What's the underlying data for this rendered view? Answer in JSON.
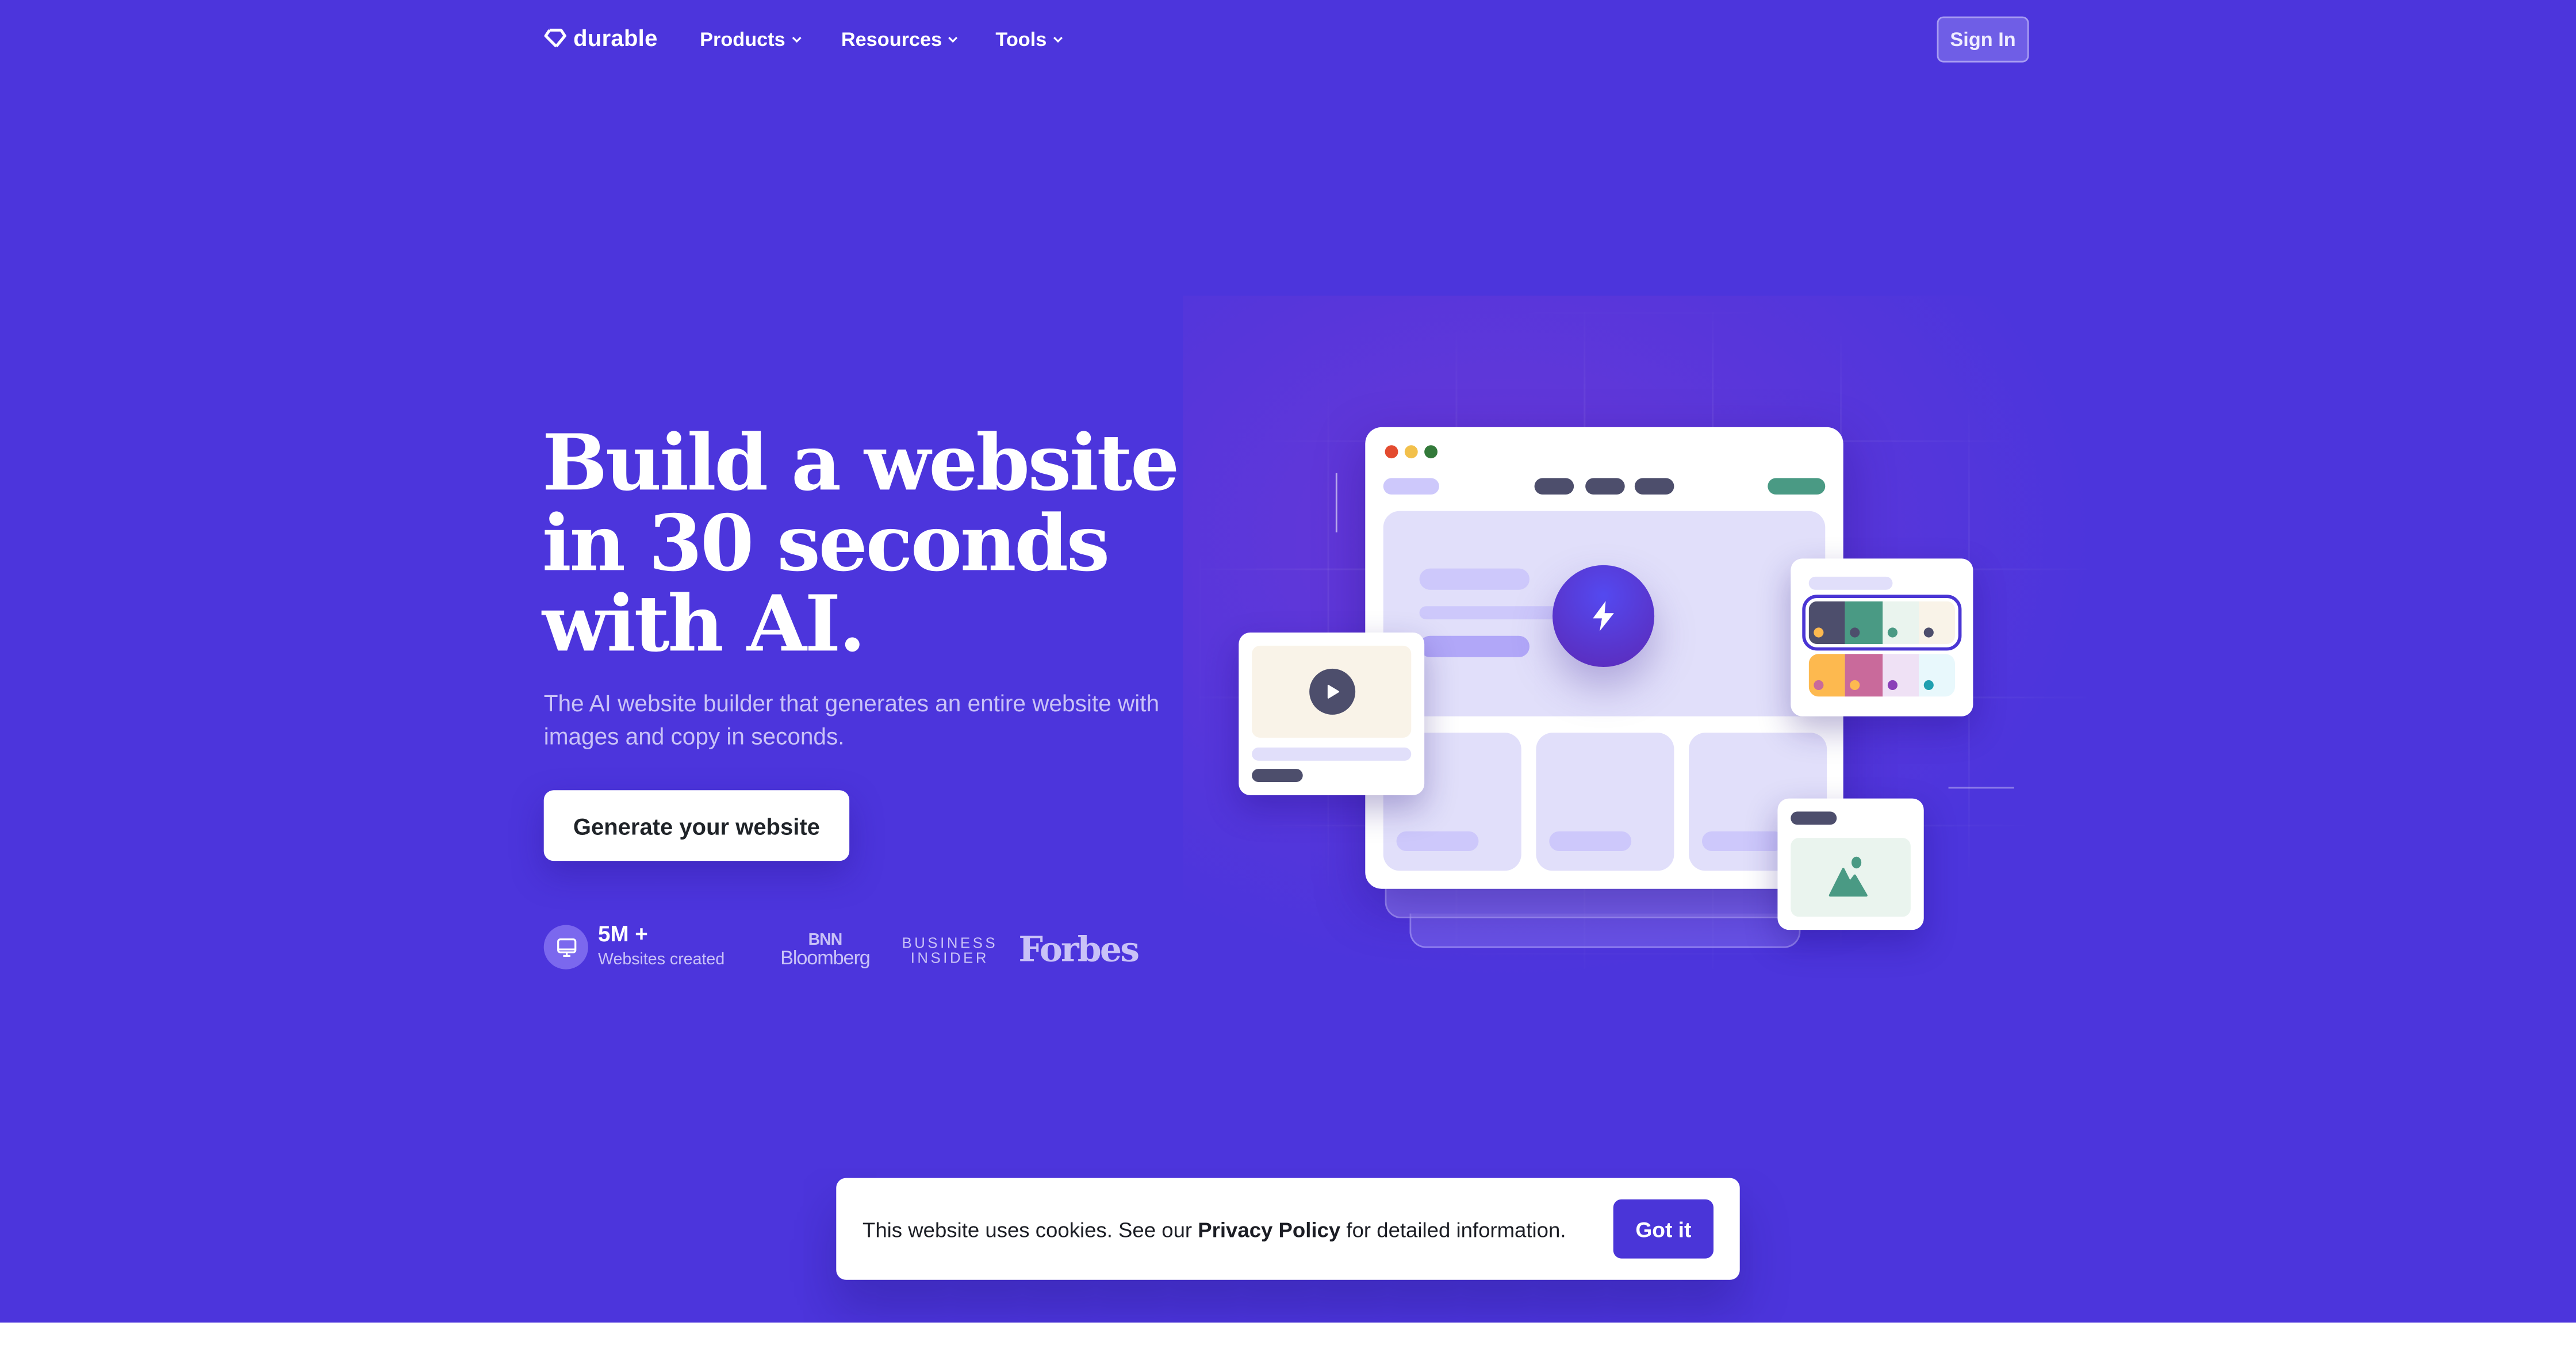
{
  "nav": {
    "logo_text": "durable",
    "items": [
      {
        "label": "Products"
      },
      {
        "label": "Resources"
      },
      {
        "label": "Tools"
      }
    ],
    "sign_in_label": "Sign In"
  },
  "hero": {
    "headline_lines": [
      "Build a website",
      "in 30 seconds",
      "with AI."
    ],
    "subtitle": "The AI website builder that generates an entire website with images and copy in seconds.",
    "cta_label": "Generate your website",
    "stat": {
      "icon": "monitor-icon",
      "value": "5M +",
      "label": "Websites created"
    },
    "press": {
      "bnn_line1": "BNN",
      "bnn_line2": "Bloomberg",
      "bi_line1": "BUSINESS",
      "bi_line2": "INSIDER",
      "forbes": "Forbes"
    }
  },
  "illustration": {
    "window_dots": [
      "#e34b2f",
      "#f2c04b",
      "#337a3a"
    ],
    "palettes": [
      {
        "selected": true,
        "swatches": [
          {
            "bg": "#4d4e6c",
            "dot": "#fdb94f"
          },
          {
            "bg": "#4a9a84",
            "dot": "#4d4e6c"
          },
          {
            "bg": "#eaf4ee",
            "dot": "#4a9a84"
          },
          {
            "bg": "#f9f3e8",
            "dot": "#4d4e6c"
          }
        ]
      },
      {
        "selected": false,
        "swatches": [
          {
            "bg": "#fdb94f",
            "dot": "#c96a9b"
          },
          {
            "bg": "#c96a9b",
            "dot": "#fdb94f"
          },
          {
            "bg": "#efe1f5",
            "dot": "#8b3fb8"
          },
          {
            "bg": "#e8f8fc",
            "dot": "#20a0b0"
          }
        ]
      }
    ]
  },
  "cookie": {
    "text_before": "This website uses cookies. See our ",
    "link_label": "Privacy Policy",
    "text_after": " for detailed information.",
    "button_label": "Got it"
  },
  "colors": {
    "brand": "#4c35dc",
    "accent_button": "#4a35d8"
  }
}
